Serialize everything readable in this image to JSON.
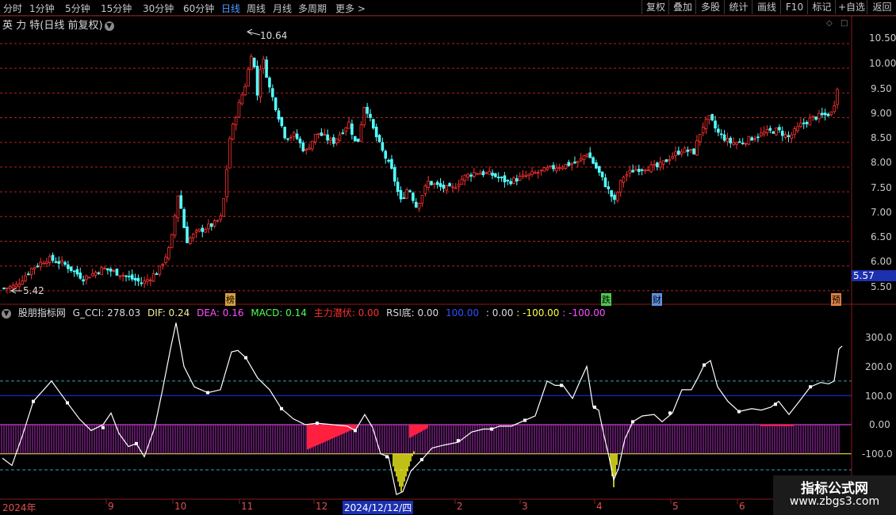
{
  "toolbar": {
    "periods": [
      "分时",
      "1分钟",
      "5分钟",
      "15分钟",
      "30分钟",
      "60分钟",
      "日线",
      "周线",
      "月线",
      "多周期",
      "更多 >"
    ],
    "active_period": "日线",
    "buttons": [
      "复权",
      "叠加",
      "多股",
      "统计",
      "画线",
      "F10",
      "标记",
      "+自选",
      "返回"
    ]
  },
  "chart_title": "英 力 特(日线 前复权)",
  "price_axis": {
    "ticks": [
      "10.50",
      "10.00",
      "9.50",
      "9.00",
      "8.50",
      "8.00",
      "7.50",
      "7.00",
      "6.50",
      "6.00",
      "5.50"
    ],
    "current_price": "5.57"
  },
  "annotations": {
    "high": "10.64",
    "low": "5.42",
    "markers": [
      "榜",
      "跌",
      "财",
      "预"
    ]
  },
  "indicator": {
    "name": "股朋指标网",
    "values": [
      {
        "label": "G_CCI: 278.03",
        "color": "#dcdcdc"
      },
      {
        "label": "DIF: 0.24",
        "color": "#f0f0a0"
      },
      {
        "label": "DEA: 0.16",
        "color": "#ff50ff"
      },
      {
        "label": "MACD: 0.14",
        "color": "#50ff50"
      },
      {
        "label": "主力潜伏: 0.00",
        "color": "#ff3030"
      },
      {
        "label": "RSI底: 0.00",
        "color": "#dcdcdc"
      },
      {
        "label": "100.00",
        "color": "#3050ff"
      },
      {
        "label": ": 0.00",
        "color": "#dcdcdc"
      },
      {
        "label": ": -100.00",
        "color": "#ffff40"
      },
      {
        "label": ": -100.00",
        "color": "#ff50ff"
      }
    ],
    "axis_ticks": [
      "300.0",
      "200.0",
      "100.0",
      "0.00",
      "-100.0"
    ]
  },
  "date_axis": {
    "labels": [
      "2024年",
      "9",
      "10",
      "11",
      "12",
      "2024/12/12/四",
      "2",
      "3",
      "4",
      "5",
      "6"
    ]
  },
  "watermark": {
    "title": "指标公式网",
    "url": "www.zbgs3.com"
  },
  "colors": {
    "up": "#ff3232",
    "down": "#54ffff",
    "grid": "#b42020",
    "cci_line": "#ffffff"
  }
}
